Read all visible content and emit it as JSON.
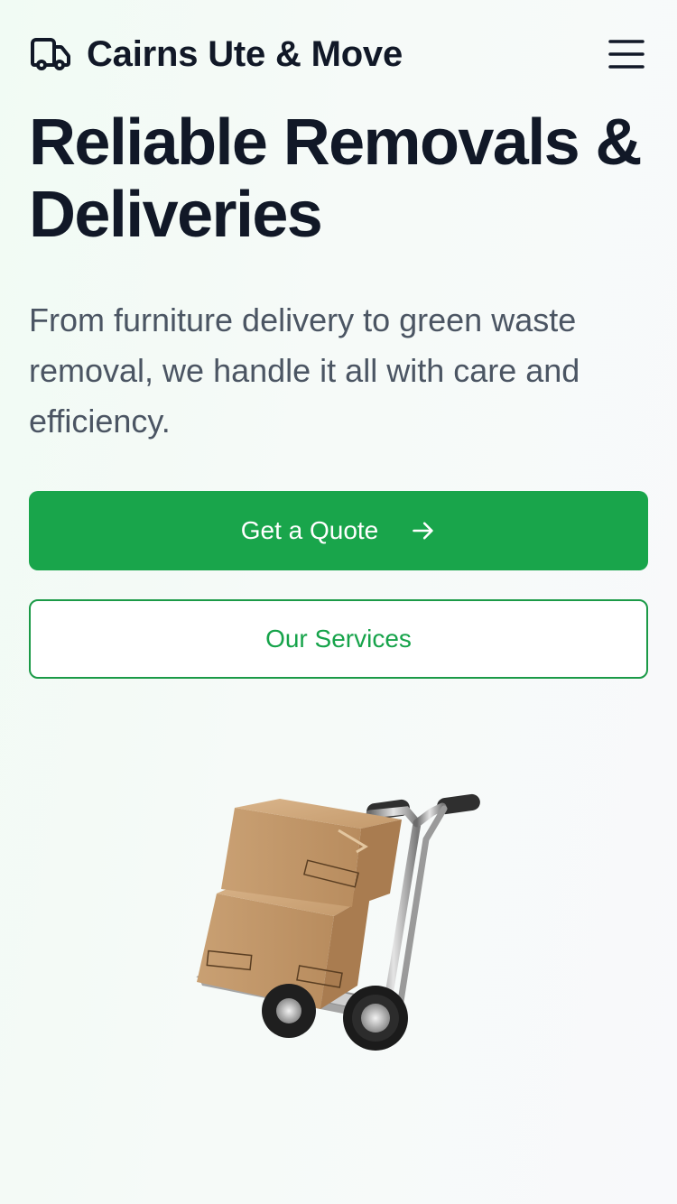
{
  "header": {
    "brand_name": "Cairns Ute & Move",
    "brand_icon": "truck-icon",
    "menu_icon": "hamburger-menu-icon"
  },
  "hero": {
    "title": "Reliable Removals & Deliveries",
    "subtitle": "From furniture delivery to green waste removal, we handle it all with care and efficiency.",
    "primary_button": "Get a Quote",
    "primary_button_icon": "arrow-right-icon",
    "secondary_button": "Our Services",
    "image": "hand-truck-with-boxes"
  },
  "colors": {
    "accent": "#19a54b",
    "heading": "#111827",
    "body_text": "#4b5563",
    "outline": "#1b9a47"
  }
}
